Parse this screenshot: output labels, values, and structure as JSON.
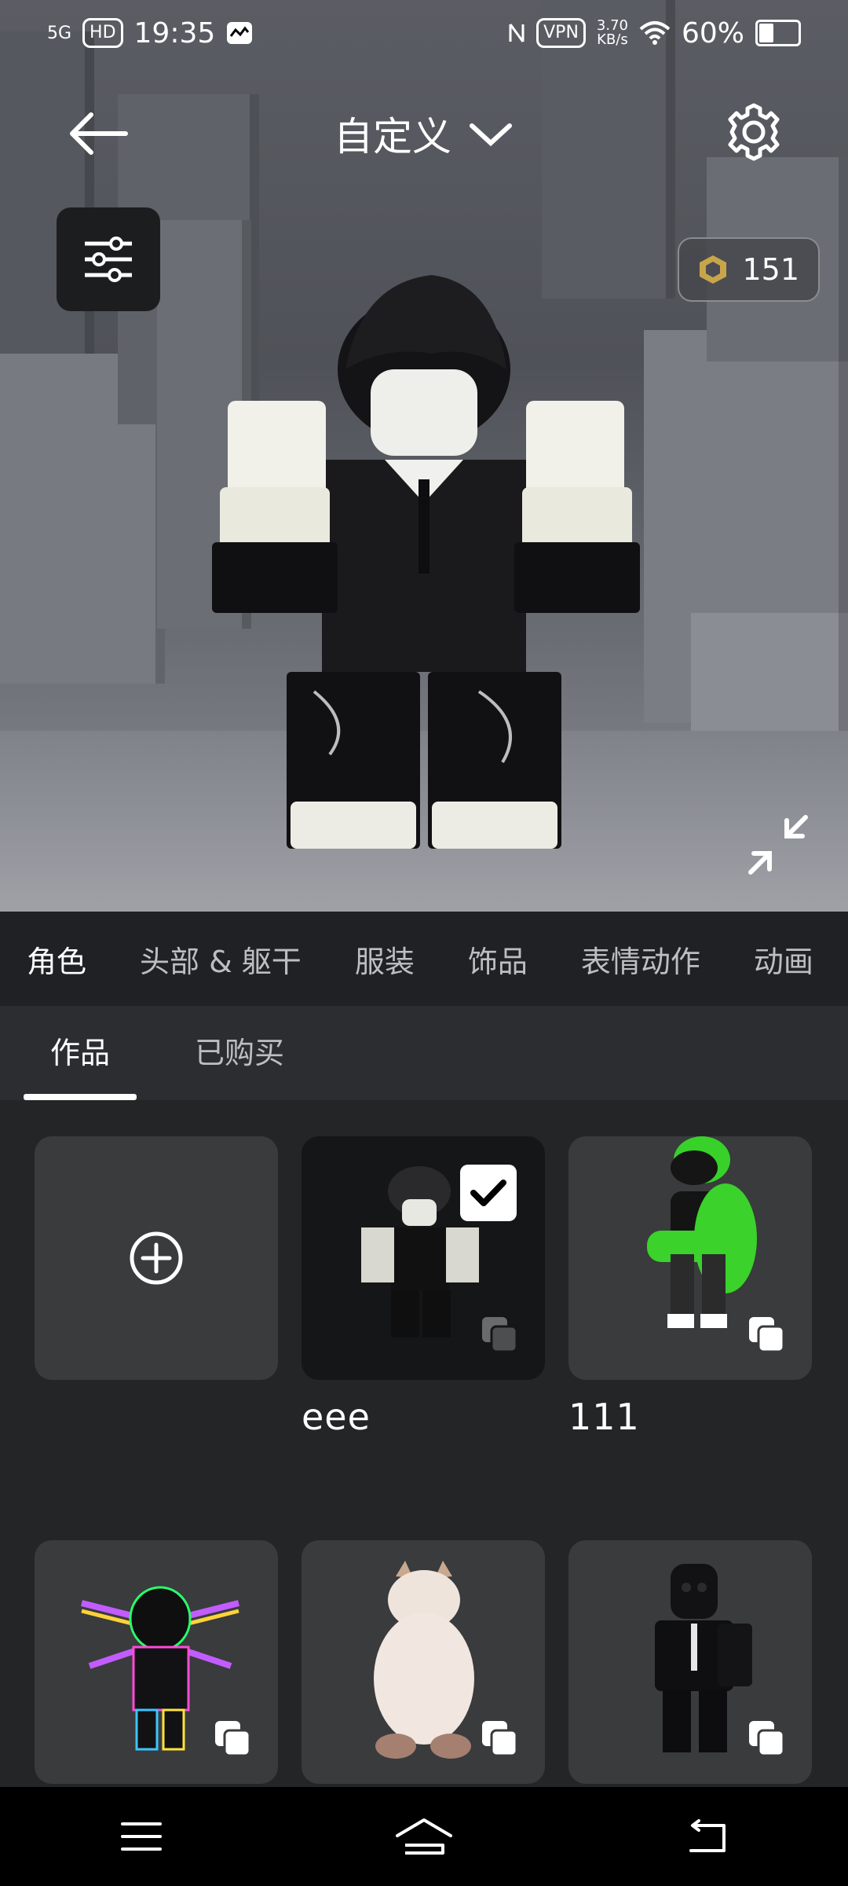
{
  "status_bar": {
    "network": "5G",
    "hd": "HD",
    "time": "19:35",
    "vpn": "VPN",
    "speed_value": "3.70",
    "speed_unit": "KB/s",
    "battery": "60%"
  },
  "header": {
    "title": "自定义"
  },
  "robux": {
    "balance": "151"
  },
  "category_tabs": [
    {
      "label": "角色"
    },
    {
      "label": "头部 & 躯干"
    },
    {
      "label": "服装"
    },
    {
      "label": "饰品"
    },
    {
      "label": "表情动作"
    },
    {
      "label": "动画"
    }
  ],
  "sub_tabs": [
    {
      "label": "作品"
    },
    {
      "label": "已购买"
    }
  ],
  "grid": {
    "items": [
      {
        "label": ""
      },
      {
        "label": "eee"
      },
      {
        "label": "111"
      },
      {
        "label": ""
      },
      {
        "label": ""
      },
      {
        "label": ""
      }
    ]
  },
  "colors": {
    "background": "#232527",
    "card": "#393b3d",
    "selected_card": "#151617",
    "text": "#ffffff"
  },
  "icons": [
    "back-arrow-icon",
    "chevron-down-icon",
    "gear-icon",
    "sliders-icon",
    "robux-icon",
    "collapse-icon",
    "plus-circle-icon",
    "check-icon",
    "stack-icon",
    "menu-icon",
    "home-icon",
    "back-icon"
  ]
}
